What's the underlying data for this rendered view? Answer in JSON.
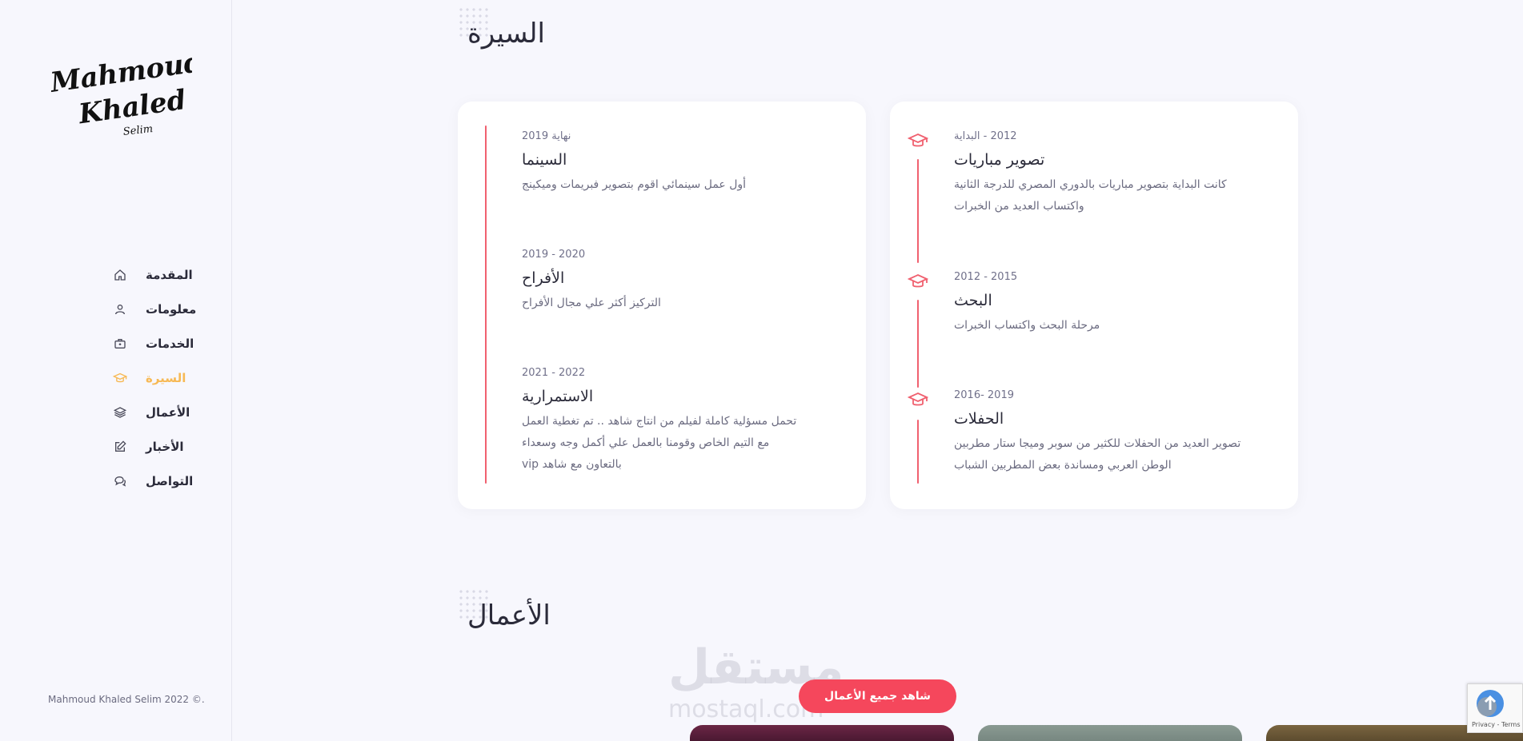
{
  "sidebar": {
    "logo": {
      "line1": "Mahmoud",
      "line2": "Khaled",
      "line3": "Selim"
    },
    "nav": [
      {
        "label": "المقدمة",
        "icon": "home-icon"
      },
      {
        "label": "معلومات",
        "icon": "user-icon"
      },
      {
        "label": "الخدمات",
        "icon": "briefcase-icon"
      },
      {
        "label": "السيرة",
        "icon": "graduation-cap-icon",
        "active": true
      },
      {
        "label": "الأعمال",
        "icon": "layers-icon"
      },
      {
        "label": "الأخبار",
        "icon": "edit-icon"
      },
      {
        "label": "التواصل",
        "icon": "chat-icon"
      }
    ],
    "copyright": "Mahmoud Khaled Selim 2022 ©."
  },
  "resume": {
    "title": "السيرة",
    "right_card": [
      {
        "date": "2012 - البداية",
        "title": "تصوير مباريات",
        "desc_lines": [
          "كانت البداية بتصوير مباريات بالدوري المصري للدرجة الثانية",
          "واكتساب العديد من الخبرات"
        ]
      },
      {
        "date": "2012 - 2015",
        "title": "البحث",
        "desc_lines": [
          "مرحلة البحث واكتساب الخبرات"
        ]
      },
      {
        "date": "2016- 2019",
        "title": "الحفلات",
        "desc_lines": [
          "تصوير العديد من الحفلات للكثير من سوبر وميجا ستار مطربين",
          "الوطن العربي ومساندة بعض المطربين الشباب"
        ]
      }
    ],
    "left_card": [
      {
        "date": "نهاية 2019",
        "title": "السينما",
        "desc_lines": [
          "أول عمل سينمائي اقوم بتصوير فبريمات وميكينج"
        ]
      },
      {
        "date": "2019 - 2020",
        "title": "الأفراح",
        "desc_lines": [
          "التركيز أكثر علي مجال الأفراح"
        ]
      },
      {
        "date": "2021 - 2022",
        "title": "الاستمرارية",
        "desc_lines": [
          "تحمل مسؤلية كاملة لفيلم من انتاج شاهد .. تم تغطية العمل",
          "مع التيم الخاص وقومنا بالعمل علي أكمل وجه وسعداء",
          "بالتعاون مع شاهد vip"
        ]
      }
    ]
  },
  "works": {
    "title": "الأعمال",
    "button_label": "شاهد جميع الأعمال"
  },
  "watermark": {
    "main": "مستقل",
    "sub": "mostaql.com"
  },
  "recaptcha": {
    "text": "Privacy - Terms"
  },
  "colors": {
    "accent": "#f5475c",
    "active_nav": "#f7b955",
    "timeline": "#f0606f"
  }
}
